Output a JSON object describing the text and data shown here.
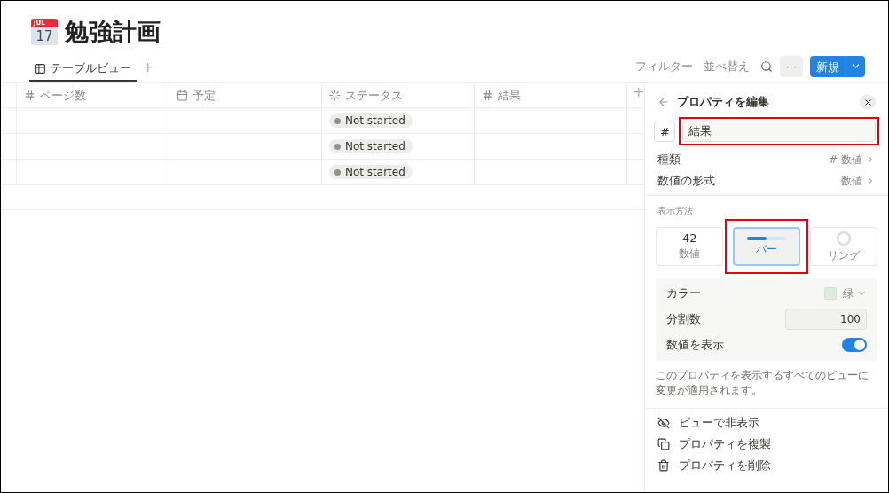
{
  "page": {
    "title": "勉強計画",
    "icon_month": "JUL",
    "icon_day": "17"
  },
  "views": [
    {
      "label": "テーブルビュー",
      "selected": true
    }
  ],
  "add_view": "+",
  "toolbar": {
    "filter": "フィルター",
    "sort": "並べ替え",
    "more": "···",
    "new": "新規"
  },
  "table": {
    "columns": [
      {
        "kind": "number",
        "label": "ページ数"
      },
      {
        "kind": "date",
        "label": "予定"
      },
      {
        "kind": "status",
        "label": "ステータス"
      },
      {
        "kind": "number",
        "label": "結果"
      }
    ],
    "add_column": "+",
    "rows": [
      {
        "status": "Not started"
      },
      {
        "status": "Not started"
      },
      {
        "status": "Not started"
      }
    ]
  },
  "panel": {
    "title": "プロパティを編集",
    "type_glyph": "#",
    "name": {
      "value": "結果",
      "highlighted": true
    },
    "settings": [
      {
        "label": "種類",
        "glyph": "#",
        "value": "数値"
      },
      {
        "label": "数値の形式",
        "value": "数値"
      }
    ],
    "display_label": "表示方法",
    "display_options": [
      {
        "kind": "number",
        "sample": "42",
        "label": "数値",
        "selected": false,
        "highlighted": false
      },
      {
        "kind": "bar",
        "label": "バー",
        "selected": true,
        "highlighted": true
      },
      {
        "kind": "ring",
        "label": "リング",
        "selected": false,
        "highlighted": false
      }
    ],
    "color": {
      "label": "カラー",
      "value": "緑"
    },
    "divisions": {
      "label": "分割数",
      "value": "100"
    },
    "show_number": {
      "label": "数値を表示",
      "on": true
    },
    "note": "このプロパティを表示するすべてのビューに変更が適用されます。",
    "actions": [
      {
        "kind": "hide",
        "label": "ビューで非表示"
      },
      {
        "kind": "duplicate",
        "label": "プロパティを複製"
      },
      {
        "kind": "delete",
        "label": "プロパティを削除"
      }
    ]
  }
}
